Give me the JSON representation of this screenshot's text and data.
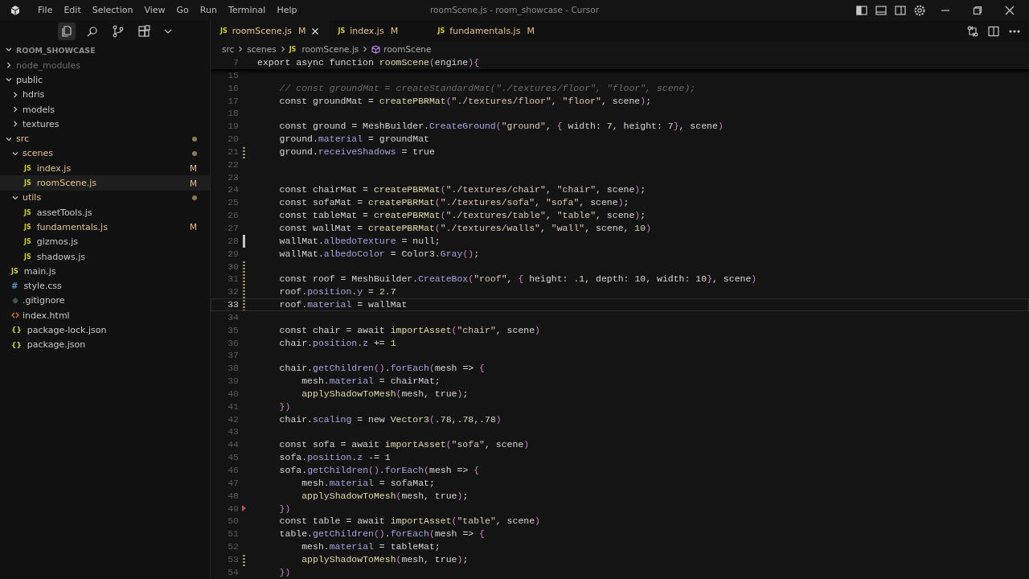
{
  "window": {
    "title": "roomScene.js - room_showcase - Cursor",
    "menu": [
      "File",
      "Edit",
      "Selection",
      "View",
      "Go",
      "Run",
      "Terminal",
      "Help"
    ]
  },
  "sidebar": {
    "title": "ROOM_SHOWCASE",
    "tree": [
      {
        "name": "node_modules",
        "kind": "folder",
        "expanded": false,
        "dimmed": true,
        "selected": false
      },
      {
        "name": "public",
        "kind": "folder",
        "expanded": true,
        "selected": false,
        "children": [
          {
            "name": "hdris",
            "kind": "folder",
            "expanded": false,
            "selected": false
          },
          {
            "name": "models",
            "kind": "folder",
            "expanded": false,
            "selected": false
          },
          {
            "name": "textures",
            "kind": "folder",
            "expanded": false,
            "selected": false
          }
        ]
      },
      {
        "name": "src",
        "kind": "folder",
        "expanded": true,
        "modified": true,
        "selected": false,
        "children": [
          {
            "name": "scenes",
            "kind": "folder",
            "expanded": true,
            "modified": true,
            "selected": false,
            "children": [
              {
                "name": "index.js",
                "kind": "js",
                "icon": "JS",
                "modified": true,
                "status": "M",
                "selected": false
              },
              {
                "name": "roomScene.js",
                "kind": "js",
                "icon": "JS",
                "modified": true,
                "status": "M",
                "selected": true
              }
            ]
          },
          {
            "name": "utils",
            "kind": "folder",
            "expanded": true,
            "modified": true,
            "selected": false,
            "children": [
              {
                "name": "assetTools.js",
                "kind": "js",
                "icon": "JS",
                "selected": false
              },
              {
                "name": "fundamentals.js",
                "kind": "js",
                "icon": "JS",
                "modified": true,
                "status": "M",
                "selected": false
              },
              {
                "name": "gizmos.js",
                "kind": "js",
                "icon": "JS",
                "selected": false
              },
              {
                "name": "shadows.js",
                "kind": "js",
                "icon": "JS",
                "selected": false
              }
            ]
          }
        ]
      },
      {
        "name": "main.js",
        "kind": "js",
        "icon": "JS",
        "selected": false
      },
      {
        "name": "style.css",
        "kind": "css",
        "icon": "#",
        "selected": false
      },
      {
        "name": ".gitignore",
        "kind": "git",
        "selected": false
      },
      {
        "name": "index.html",
        "kind": "html",
        "selected": false
      },
      {
        "name": "package-lock.json",
        "kind": "json",
        "icon": "{}",
        "selected": false
      },
      {
        "name": "package.json",
        "kind": "json",
        "icon": "{}",
        "selected": false
      }
    ]
  },
  "tabs": [
    {
      "label": "roomScene.js",
      "icon": "JS",
      "status": "M",
      "selected": true
    },
    {
      "label": "index.js",
      "icon": "JS",
      "status": "M",
      "selected": false
    },
    {
      "label": "fundamentals.js",
      "icon": "JS",
      "status": "M",
      "selected": false
    }
  ],
  "breadcrumb": [
    {
      "label": "src",
      "kind": "folder"
    },
    {
      "label": "scenes",
      "kind": "folder"
    },
    {
      "label": "roomScene.js",
      "kind": "file",
      "icon": "JS"
    },
    {
      "label": "roomScene",
      "kind": "symbol"
    }
  ],
  "editor": {
    "sticky_line": {
      "n": "7",
      "text": "export async function roomScene(engine){"
    },
    "lines": [
      {
        "n": "15",
        "current": false
      },
      {
        "n": "16",
        "text": "    // const groundMat = createStandardMat(\"./textures/floor\", \"floor\", scene);",
        "current": false
      },
      {
        "n": "17",
        "text": "    const groundMat = createPBRMat(\"./textures/floor\", \"floor\", scene);",
        "current": false
      },
      {
        "n": "18",
        "current": false
      },
      {
        "n": "19",
        "text": "    const ground = MeshBuilder.CreateGround(\"ground\", { width: 7, height: 7}, scene)",
        "current": false
      },
      {
        "n": "20",
        "text": "    ground.material = groundMat",
        "current": false
      },
      {
        "n": "21",
        "text": "    ground.receiveShadows = true",
        "current": false,
        "modified": true
      },
      {
        "n": "22",
        "current": false
      },
      {
        "n": "23",
        "current": false
      },
      {
        "n": "24",
        "text": "    const chairMat = createPBRMat(\"./textures/chair\", \"chair\", scene);",
        "current": false
      },
      {
        "n": "25",
        "text": "    const sofaMat = createPBRMat(\"./textures/sofa\", \"sofa\", scene);",
        "current": false
      },
      {
        "n": "26",
        "text": "    const tableMat = createPBRMat(\"./textures/table\", \"table\", scene);",
        "current": false
      },
      {
        "n": "27",
        "text": "    const wallMat = createPBRMat(\"./textures/walls\", \"wall\", scene, 10)",
        "current": false
      },
      {
        "n": "28",
        "text": "    wallMat.albedoTexture = null;",
        "current": false,
        "added": true
      },
      {
        "n": "29",
        "text": "    wallMat.albedoColor = Color3.Gray();",
        "current": false
      },
      {
        "n": "30",
        "current": false,
        "modified": true
      },
      {
        "n": "31",
        "text": "    const roof = MeshBuilder.CreateBox(\"roof\", { height: .1, depth: 10, width: 10}, scene)",
        "current": false,
        "modified": true
      },
      {
        "n": "32",
        "text": "    roof.position.y = 2.7",
        "current": false,
        "modified": true
      },
      {
        "n": "33",
        "text": "    roof.material = wallMat",
        "current": true,
        "modified": true
      },
      {
        "n": "34",
        "current": false
      },
      {
        "n": "35",
        "text": "    const chair = await importAsset(\"chair\", scene)",
        "current": false
      },
      {
        "n": "36",
        "text": "    chair.position.z += 1",
        "current": false
      },
      {
        "n": "37",
        "current": false
      },
      {
        "n": "38",
        "text": "    chair.getChildren().forEach(mesh => {",
        "current": false
      },
      {
        "n": "39",
        "text": "        mesh.material = chairMat;",
        "current": false
      },
      {
        "n": "40",
        "text": "        applyShadowToMesh(mesh, true);",
        "current": false
      },
      {
        "n": "41",
        "text": "    })",
        "current": false
      },
      {
        "n": "42",
        "text": "    chair.scaling = new Vector3(.78,.78,.78)",
        "current": false
      },
      {
        "n": "43",
        "current": false
      },
      {
        "n": "44",
        "text": "    const sofa = await importAsset(\"sofa\", scene)",
        "current": false
      },
      {
        "n": "45",
        "text": "    sofa.position.z -= 1",
        "current": false
      },
      {
        "n": "46",
        "text": "    sofa.getChildren().forEach(mesh => {",
        "current": false
      },
      {
        "n": "47",
        "text": "        mesh.material = sofaMat;",
        "current": false
      },
      {
        "n": "48",
        "text": "        applyShadowToMesh(mesh, true);",
        "current": false
      },
      {
        "n": "49",
        "text": "    })",
        "current": false,
        "deleted": true
      },
      {
        "n": "50",
        "text": "    const table = await importAsset(\"table\", scene)",
        "current": false
      },
      {
        "n": "51",
        "text": "    table.getChildren().forEach(mesh => {",
        "current": false
      },
      {
        "n": "52",
        "text": "        mesh.material = tableMat;",
        "current": false
      },
      {
        "n": "53",
        "text": "        applyShadowToMesh(mesh, true);",
        "current": false,
        "modified": true
      },
      {
        "n": "54",
        "text": "    })",
        "current": false
      }
    ]
  }
}
